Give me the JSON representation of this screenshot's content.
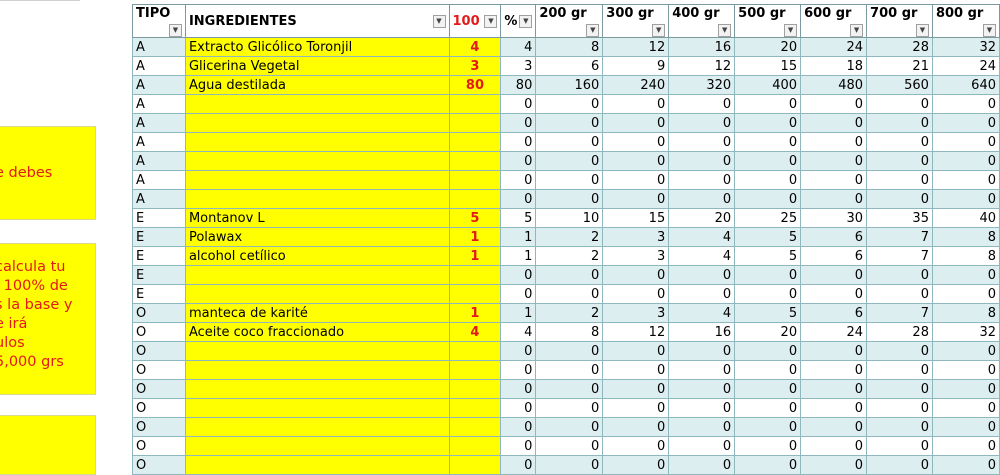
{
  "notes": [
    {
      "lines": [
        "e debes"
      ]
    },
    {
      "lines": [
        "calcula tu",
        "l 100% de",
        "s la base y",
        "e irá",
        "ulos",
        "5,000 grs"
      ]
    },
    {
      "lines": [
        "."
      ]
    }
  ],
  "table": {
    "headers": {
      "tipo": "TIPO",
      "ingredientes": "INGREDIENTES",
      "total": "100",
      "pct": "%",
      "sizes": [
        "200 gr",
        "300 gr",
        "400 gr",
        "500 gr",
        "600 gr",
        "700 gr",
        "800 gr"
      ]
    },
    "dropdown_glyph": "▼",
    "rows": [
      {
        "tipo": "A",
        "ingrediente": "Extracto Glicólico Toronjil",
        "pct": "4",
        "values": [
          "4",
          "8",
          "12",
          "16",
          "20",
          "24",
          "28",
          "32"
        ]
      },
      {
        "tipo": "A",
        "ingrediente": "Glicerina Vegetal",
        "pct": "3",
        "values": [
          "3",
          "6",
          "9",
          "12",
          "15",
          "18",
          "21",
          "24"
        ]
      },
      {
        "tipo": "A",
        "ingrediente": "Agua destilada",
        "pct": "80",
        "values": [
          "80",
          "160",
          "240",
          "320",
          "400",
          "480",
          "560",
          "640"
        ]
      },
      {
        "tipo": "A",
        "ingrediente": "",
        "pct": "",
        "values": [
          "0",
          "0",
          "0",
          "0",
          "0",
          "0",
          "0",
          "0"
        ]
      },
      {
        "tipo": "A",
        "ingrediente": "",
        "pct": "",
        "values": [
          "0",
          "0",
          "0",
          "0",
          "0",
          "0",
          "0",
          "0"
        ]
      },
      {
        "tipo": "A",
        "ingrediente": "",
        "pct": "",
        "values": [
          "0",
          "0",
          "0",
          "0",
          "0",
          "0",
          "0",
          "0"
        ]
      },
      {
        "tipo": "A",
        "ingrediente": "",
        "pct": "",
        "values": [
          "0",
          "0",
          "0",
          "0",
          "0",
          "0",
          "0",
          "0"
        ]
      },
      {
        "tipo": "A",
        "ingrediente": "",
        "pct": "",
        "values": [
          "0",
          "0",
          "0",
          "0",
          "0",
          "0",
          "0",
          "0"
        ]
      },
      {
        "tipo": "A",
        "ingrediente": "",
        "pct": "",
        "values": [
          "0",
          "0",
          "0",
          "0",
          "0",
          "0",
          "0",
          "0"
        ]
      },
      {
        "tipo": "E",
        "ingrediente": "Montanov L",
        "pct": "5",
        "values": [
          "5",
          "10",
          "15",
          "20",
          "25",
          "30",
          "35",
          "40"
        ]
      },
      {
        "tipo": "E",
        "ingrediente": "Polawax",
        "pct": "1",
        "values": [
          "1",
          "2",
          "3",
          "4",
          "5",
          "6",
          "7",
          "8"
        ]
      },
      {
        "tipo": "E",
        "ingrediente": "alcohol cetílico",
        "pct": "1",
        "values": [
          "1",
          "2",
          "3",
          "4",
          "5",
          "6",
          "7",
          "8"
        ]
      },
      {
        "tipo": "E",
        "ingrediente": "",
        "pct": "",
        "values": [
          "0",
          "0",
          "0",
          "0",
          "0",
          "0",
          "0",
          "0"
        ]
      },
      {
        "tipo": "E",
        "ingrediente": "",
        "pct": "",
        "values": [
          "0",
          "0",
          "0",
          "0",
          "0",
          "0",
          "0",
          "0"
        ]
      },
      {
        "tipo": "O",
        "ingrediente": "manteca de karité",
        "pct": "1",
        "values": [
          "1",
          "2",
          "3",
          "4",
          "5",
          "6",
          "7",
          "8"
        ]
      },
      {
        "tipo": "O",
        "ingrediente": "Aceite coco fraccionado",
        "pct": "4",
        "values": [
          "4",
          "8",
          "12",
          "16",
          "20",
          "24",
          "28",
          "32"
        ]
      },
      {
        "tipo": "O",
        "ingrediente": "",
        "pct": "",
        "values": [
          "0",
          "0",
          "0",
          "0",
          "0",
          "0",
          "0",
          "0"
        ]
      },
      {
        "tipo": "O",
        "ingrediente": "",
        "pct": "",
        "values": [
          "0",
          "0",
          "0",
          "0",
          "0",
          "0",
          "0",
          "0"
        ]
      },
      {
        "tipo": "O",
        "ingrediente": "",
        "pct": "",
        "values": [
          "0",
          "0",
          "0",
          "0",
          "0",
          "0",
          "0",
          "0"
        ]
      },
      {
        "tipo": "O",
        "ingrediente": "",
        "pct": "",
        "values": [
          "0",
          "0",
          "0",
          "0",
          "0",
          "0",
          "0",
          "0"
        ]
      },
      {
        "tipo": "O",
        "ingrediente": "",
        "pct": "",
        "values": [
          "0",
          "0",
          "0",
          "0",
          "0",
          "0",
          "0",
          "0"
        ]
      },
      {
        "tipo": "O",
        "ingrediente": "",
        "pct": "",
        "values": [
          "0",
          "0",
          "0",
          "0",
          "0",
          "0",
          "0",
          "0"
        ]
      },
      {
        "tipo": "O",
        "ingrediente": "",
        "pct": "",
        "values": [
          "0",
          "0",
          "0",
          "0",
          "0",
          "0",
          "0",
          "0"
        ]
      }
    ]
  },
  "colors": {
    "highlight_yellow": "#ffff00",
    "accent_red": "#e31a1a",
    "band_teal": "#ddeef0",
    "grid_line": "#8eb8be"
  }
}
